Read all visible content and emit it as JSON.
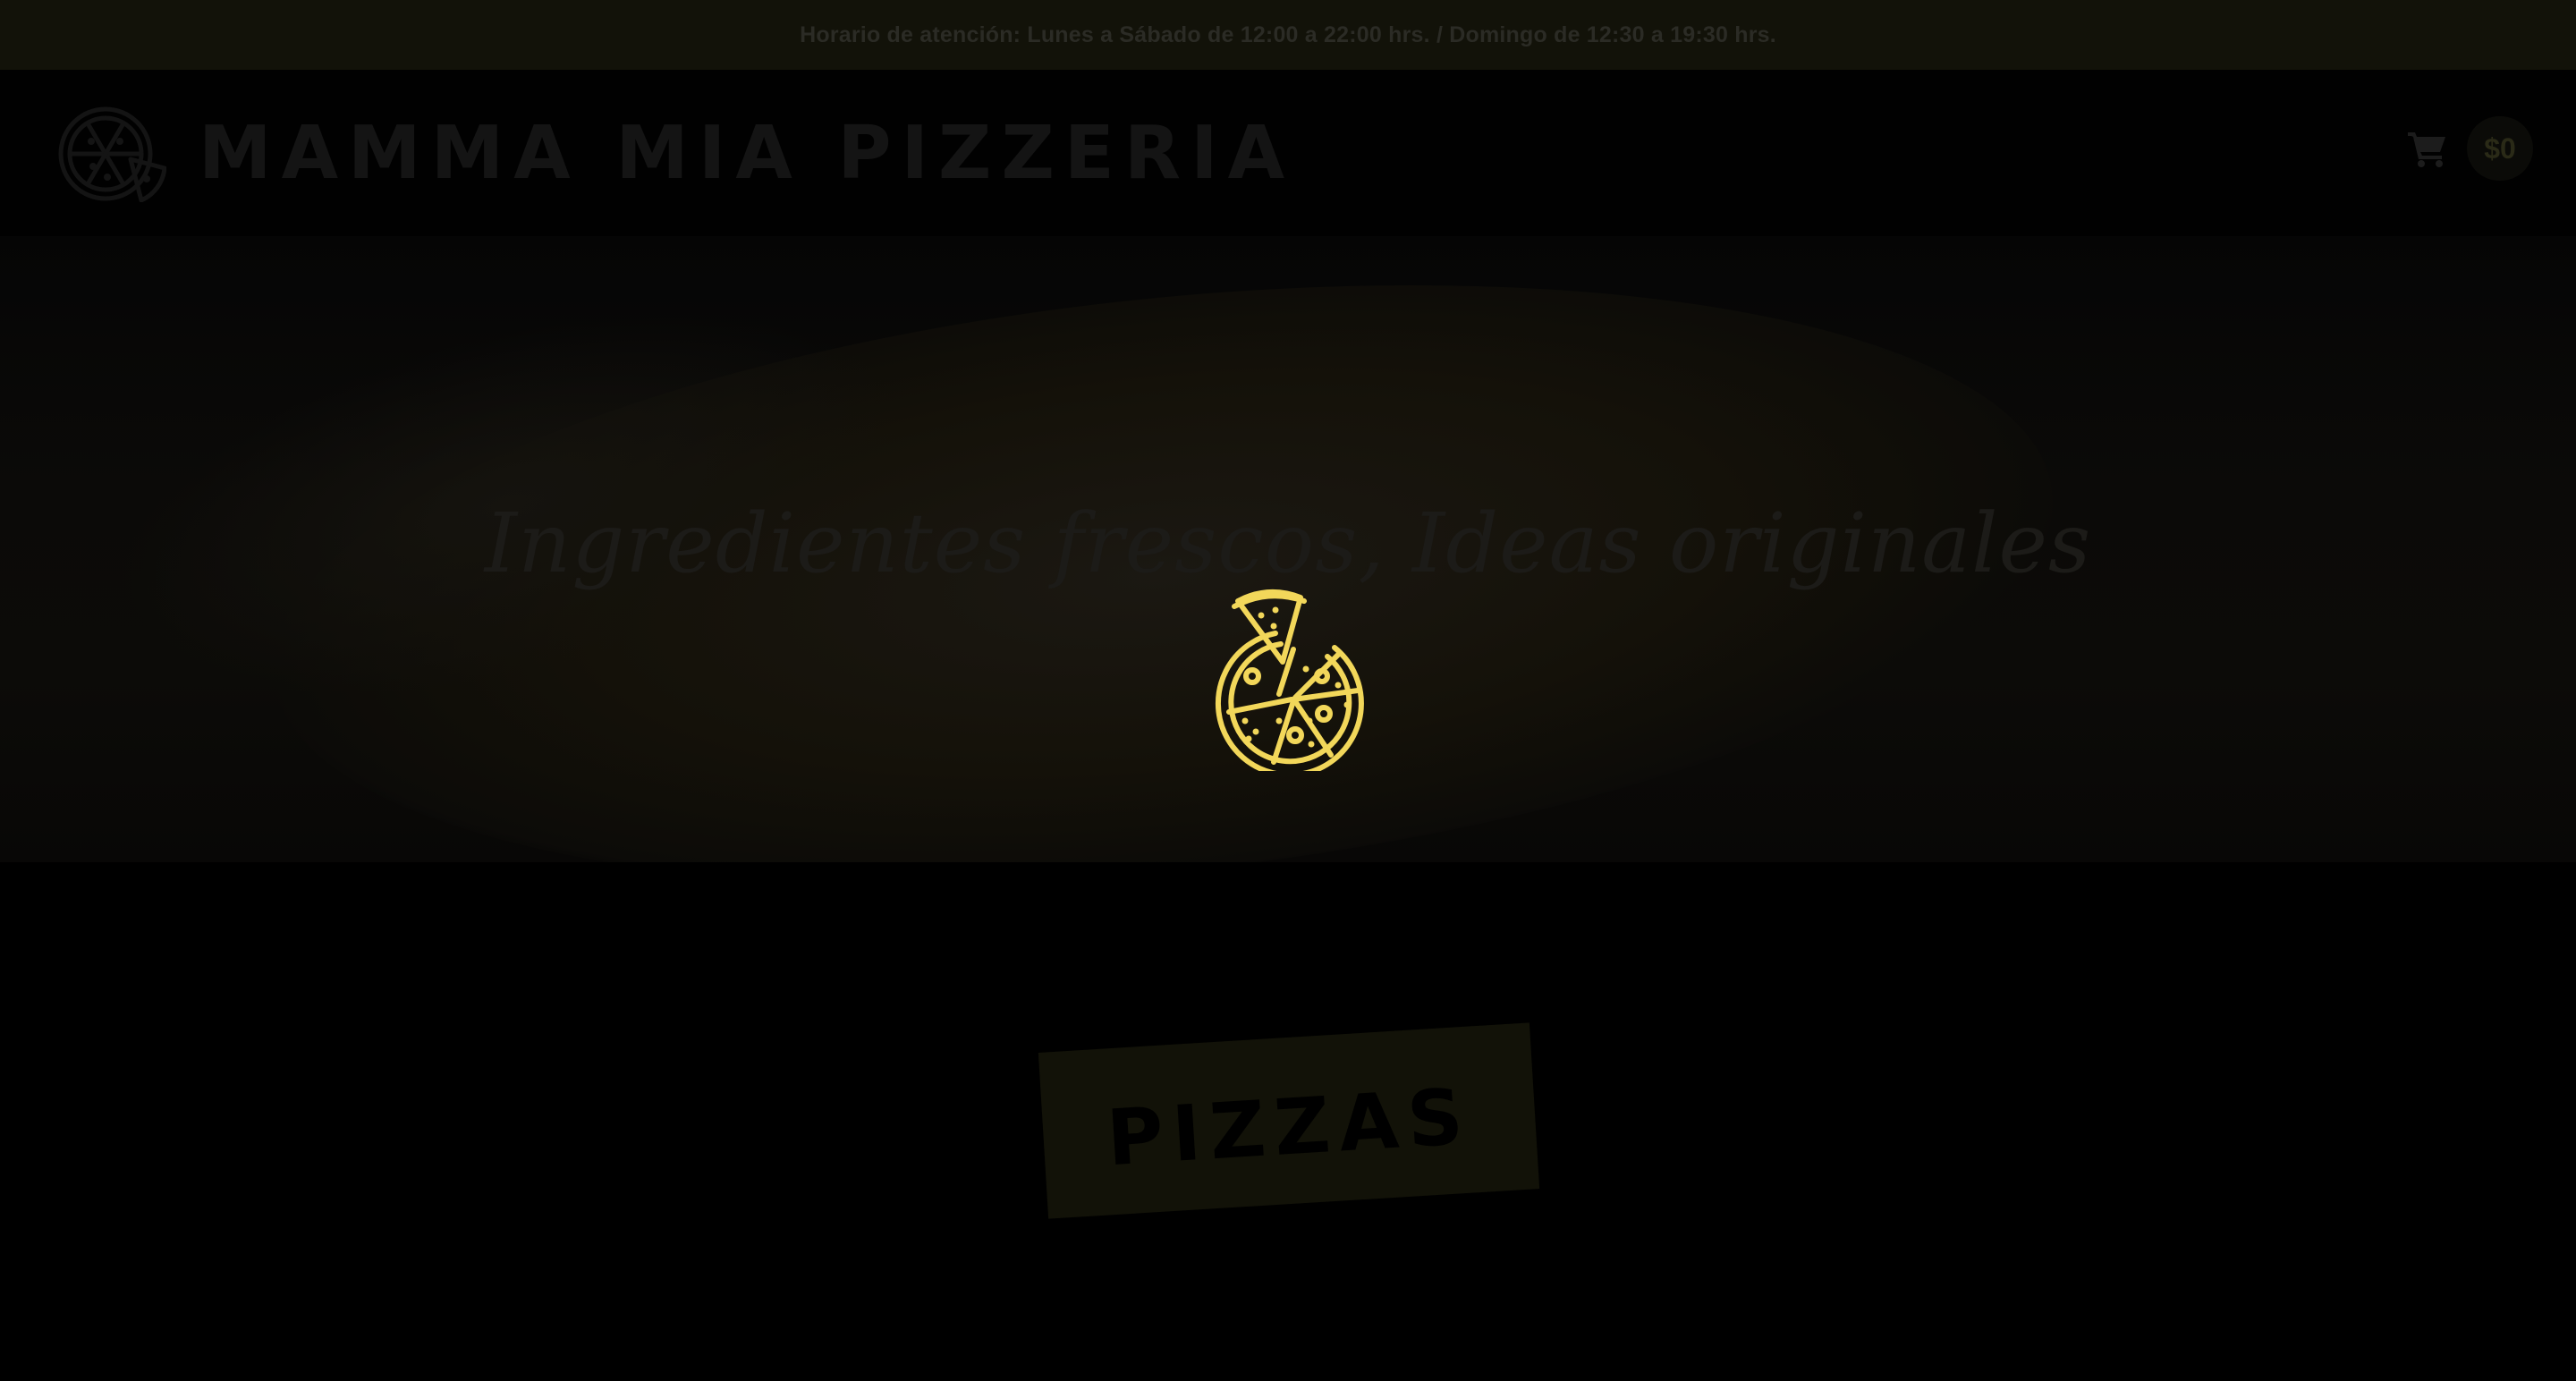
{
  "announcement": {
    "text": "Horario de atención: Lunes a Sábado de 12:00 a 22:00 hrs. / Domingo de 12:30 a 19:30 hrs."
  },
  "header": {
    "brand": "MAMMA MIA PIZZERIA",
    "logo_icon": "pizza-logo-icon",
    "cart_icon": "shopping-cart-icon",
    "cart_count": "$0"
  },
  "hero": {
    "tagline": "Ingredientes frescos, Ideas originales",
    "loader_icon": "pizza-slice-icon"
  },
  "section": {
    "title": "PIZZAS"
  },
  "colors": {
    "accent": "#f2d75a",
    "background": "#000000",
    "announcement_bg": "#121209"
  }
}
